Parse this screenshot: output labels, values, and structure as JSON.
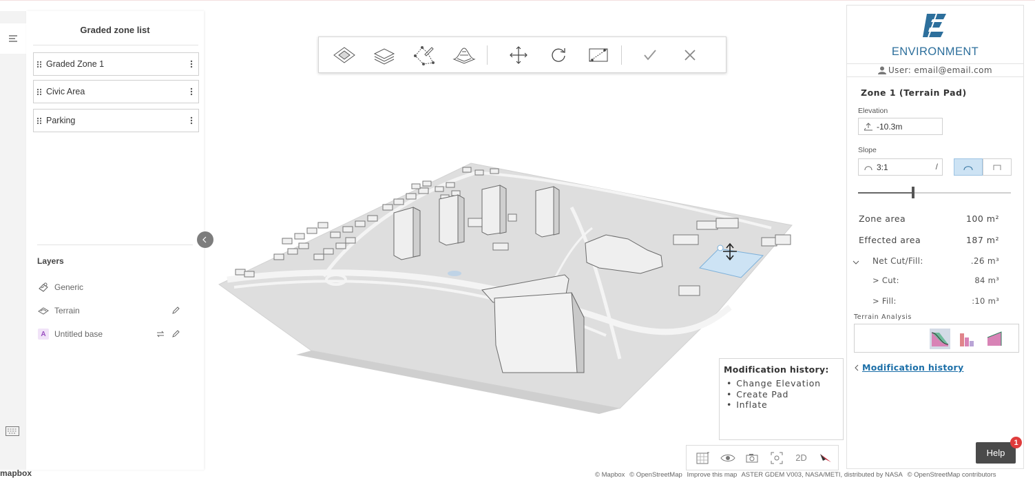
{
  "left_panel": {
    "title": "Graded zone list",
    "zones": [
      {
        "label": "Graded Zone 1"
      },
      {
        "label": "Civic Area"
      },
      {
        "label": "Parking"
      }
    ],
    "layers_title": "Layers",
    "layers": [
      {
        "label": "Generic",
        "icon": "generic-layer-icon"
      },
      {
        "label": "Terrain",
        "icon": "terrain-layer-icon"
      },
      {
        "label": "Untitled base",
        "icon": "base-layer-icon",
        "badge": "A"
      }
    ]
  },
  "toolbar": {
    "tools": [
      "terrain-pad-icon",
      "layers-stack-icon",
      "draw-polygon-icon",
      "terrain-mesh-icon",
      "move-icon",
      "rotate-icon",
      "slope-edit-icon",
      "confirm-icon",
      "cancel-icon"
    ]
  },
  "modification_box": {
    "title": "Modification history:",
    "items": [
      "Change Elevation",
      "Create Pad",
      "Inflate"
    ]
  },
  "bottom_bar": {
    "mode_label": "2D",
    "tools": [
      "grid-icon",
      "visibility-icon",
      "camera-icon",
      "focus-icon",
      "2d-toggle",
      "compass-icon"
    ]
  },
  "attribution": {
    "items": [
      "© Mapbox",
      "© OpenStreetMap",
      "Improve this map",
      "ASTER GDEM V003, NASA/METI, distributed by NASA",
      "© OpenStreetMap contributors"
    ],
    "logo": "mapbox"
  },
  "right_panel": {
    "brand": "ENVIRONMENT",
    "user": "User: email@email.com",
    "zone_title": "Zone 1 (Terrain Pad)",
    "elevation_label": "Elevation",
    "elevation_value": "-10.3m",
    "slope_label": "Slope",
    "slope_value": "3:1",
    "slope_separator": "/",
    "slope_level": 0.36,
    "stats": {
      "zone_area_label": "Zone area",
      "zone_area_value": "100 m²",
      "effected_area_label": "Effected area",
      "effected_area_value": "187 m²",
      "net_label": "Net Cut/Fill:",
      "net_value": ".26 m³",
      "cut_label": "> Cut:",
      "cut_value": "84 m³",
      "fill_label": "> Fill:",
      "fill_value": ":10 m³"
    },
    "terrain_analysis_label": "Terrain Analysis",
    "mod_history_link": "Modification history"
  },
  "help": {
    "label": "Help",
    "badge": "1"
  },
  "colors": {
    "brand_blue": "#2d6f9c",
    "link_blue": "#1c6fa8",
    "selection_blue": "#cde3f4",
    "help_bg": "#4a4a4a",
    "badge_red": "#e03c3c"
  }
}
